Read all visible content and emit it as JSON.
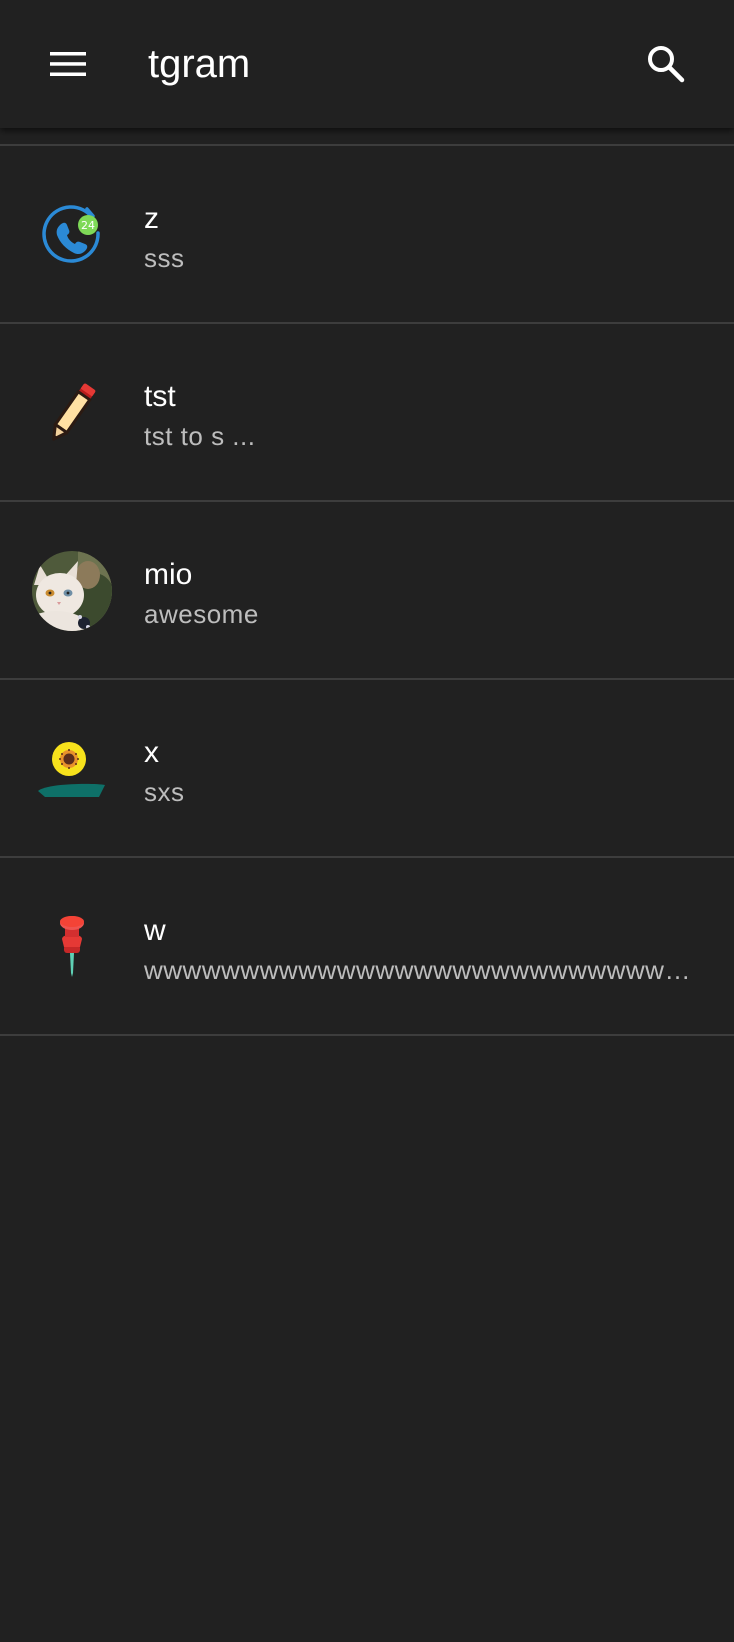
{
  "app_bar": {
    "title": "tgram",
    "menu_icon": "hamburger-menu-icon",
    "search_icon": "search-icon"
  },
  "colors": {
    "background": "#212121",
    "divider": "#3d3d3d",
    "primary_text": "#ffffff",
    "secondary_text": "#bdbdbd"
  },
  "chats": [
    {
      "title": "z",
      "subtitle": "sss",
      "avatar": "phone-24-icon"
    },
    {
      "title": "tst",
      "subtitle": "tst to s ...",
      "avatar": "pencil-icon"
    },
    {
      "title": "mio",
      "subtitle": "awesome",
      "avatar": "cat-photo"
    },
    {
      "title": "x",
      "subtitle": "sxs",
      "avatar": "flower-person-icon"
    },
    {
      "title": "w",
      "subtitle": "wwwwwwwwwwwwwwwwwwwwwwwwwwwwwwwwwwwwwwwwwwwww",
      "avatar": "pushpin-icon"
    }
  ],
  "badge_text": "24"
}
